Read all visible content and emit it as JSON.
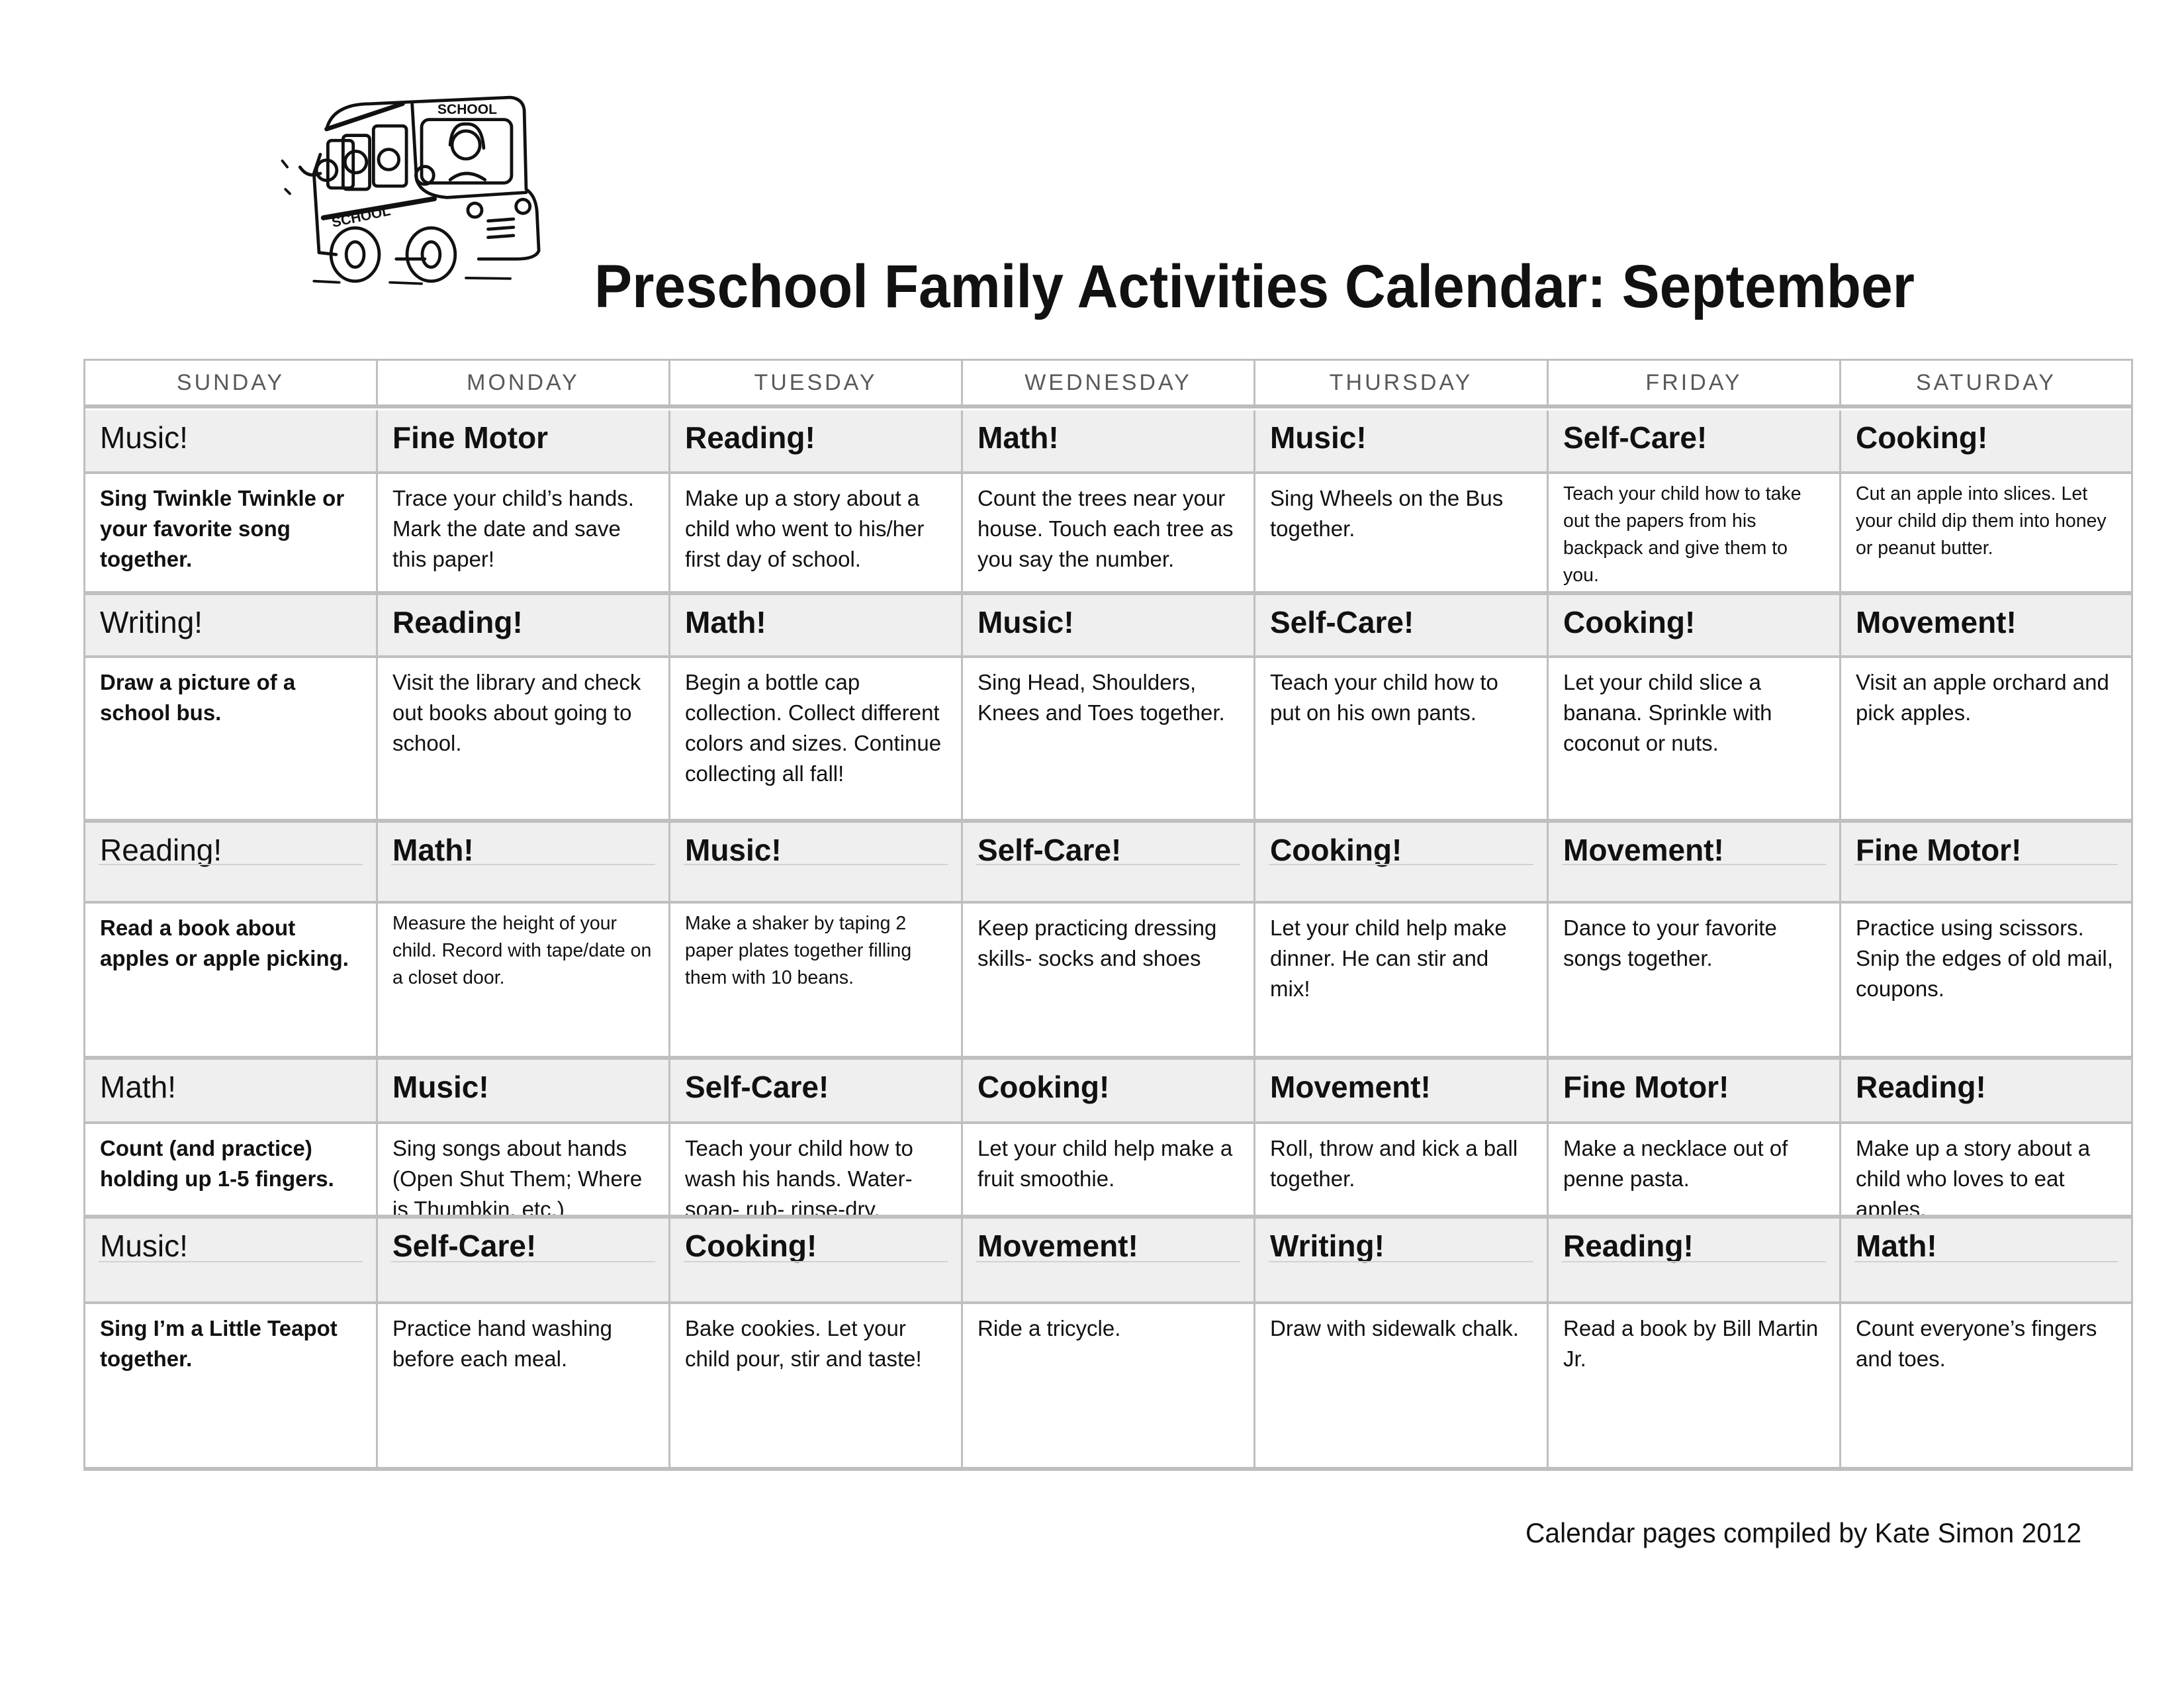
{
  "document": {
    "title": "Preschool Family Activities Calendar: September",
    "illustration": "school-bus-clipart",
    "footer": "Calendar pages compiled by Kate Simon 2012"
  },
  "calendar": {
    "days": [
      "SUNDAY",
      "MONDAY",
      "TUESDAY",
      "WEDNESDAY",
      "THURSDAY",
      "FRIDAY",
      "SATURDAY"
    ],
    "weeks": [
      {
        "categories": [
          "Music!",
          "Fine Motor",
          "Reading!",
          "Math!",
          "Music!",
          "Self-Care!",
          "Cooking!"
        ],
        "activities": [
          "Sing Twinkle Twinkle or your favorite song together.",
          "Trace your child’s hands.  Mark the date and save this paper!",
          "Make up a story about a child who went to his/her first day of school.",
          "Count the trees near your house.  Touch each tree as you say the number.",
          "Sing Wheels on the Bus together.",
          "Teach your child how to take out the papers from his backpack and give them to you.",
          "Cut an apple into slices.  Let your child dip them into honey or peanut butter."
        ]
      },
      {
        "categories": [
          "Writing!",
          "Reading!",
          "Math!",
          "Music!",
          "Self-Care!",
          "Cooking!",
          "Movement!"
        ],
        "activities": [
          "Draw a picture of a school bus.",
          "Visit the library and check out books about going to school.",
          "Begin a bottle cap collection. Collect different colors and sizes. Continue collecting all fall!",
          "Sing Head, Shoulders, Knees and Toes together.",
          "Teach your child how to put on his own pants.",
          "Let your child slice a banana.  Sprinkle with coconut or nuts.",
          "Visit an apple orchard and pick apples."
        ]
      },
      {
        "categories": [
          "Reading!",
          "Math!",
          "Music!",
          "Self-Care!",
          "Cooking!",
          "Movement!",
          "Fine Motor!"
        ],
        "activities": [
          "Read a book about apples or apple picking.",
          "Measure the height of your child. Record with tape/date on a closet door.",
          "Make a shaker by taping 2 paper plates together filling them with 10 beans.",
          "Keep practicing dressing skills- socks and shoes",
          "Let your child help make dinner. He can stir and mix!",
          "Dance to your favorite songs together.",
          "Practice using scissors.  Snip the edges of old mail, coupons."
        ]
      },
      {
        "categories": [
          "Math!",
          "Music!",
          "Self-Care!",
          "Cooking!",
          "Movement!",
          "Fine Motor!",
          "Reading!"
        ],
        "activities": [
          "Count (and practice) holding up 1-5 fingers.",
          "Sing songs about hands (Open Shut Them; Where is Thumbkin, etc.)",
          "Teach your child how to wash his hands. Water-soap- rub- rinse-dry.",
          "Let your child help make a fruit smoothie.",
          "Roll, throw and kick a ball together.",
          "Make a necklace out of penne pasta.",
          "Make up a story about a child who loves to eat apples."
        ]
      },
      {
        "categories": [
          "Music!",
          "Self-Care!",
          "Cooking!",
          "Movement!",
          "Writing!",
          "Reading!",
          "Math!"
        ],
        "activities": [
          "Sing I’m a Little Teapot together.",
          "Practice hand washing before each meal.",
          "Bake cookies.  Let your child pour, stir and taste!",
          "Ride a tricycle.",
          "Draw with sidewalk chalk.",
          "Read a book by Bill Martin Jr.",
          "Count everyone’s fingers and toes."
        ]
      }
    ]
  },
  "colors": {
    "grid_border": "#bfbfbf",
    "category_background": "#efefef",
    "day_header_text": "#595959",
    "body_text": "#111111"
  }
}
